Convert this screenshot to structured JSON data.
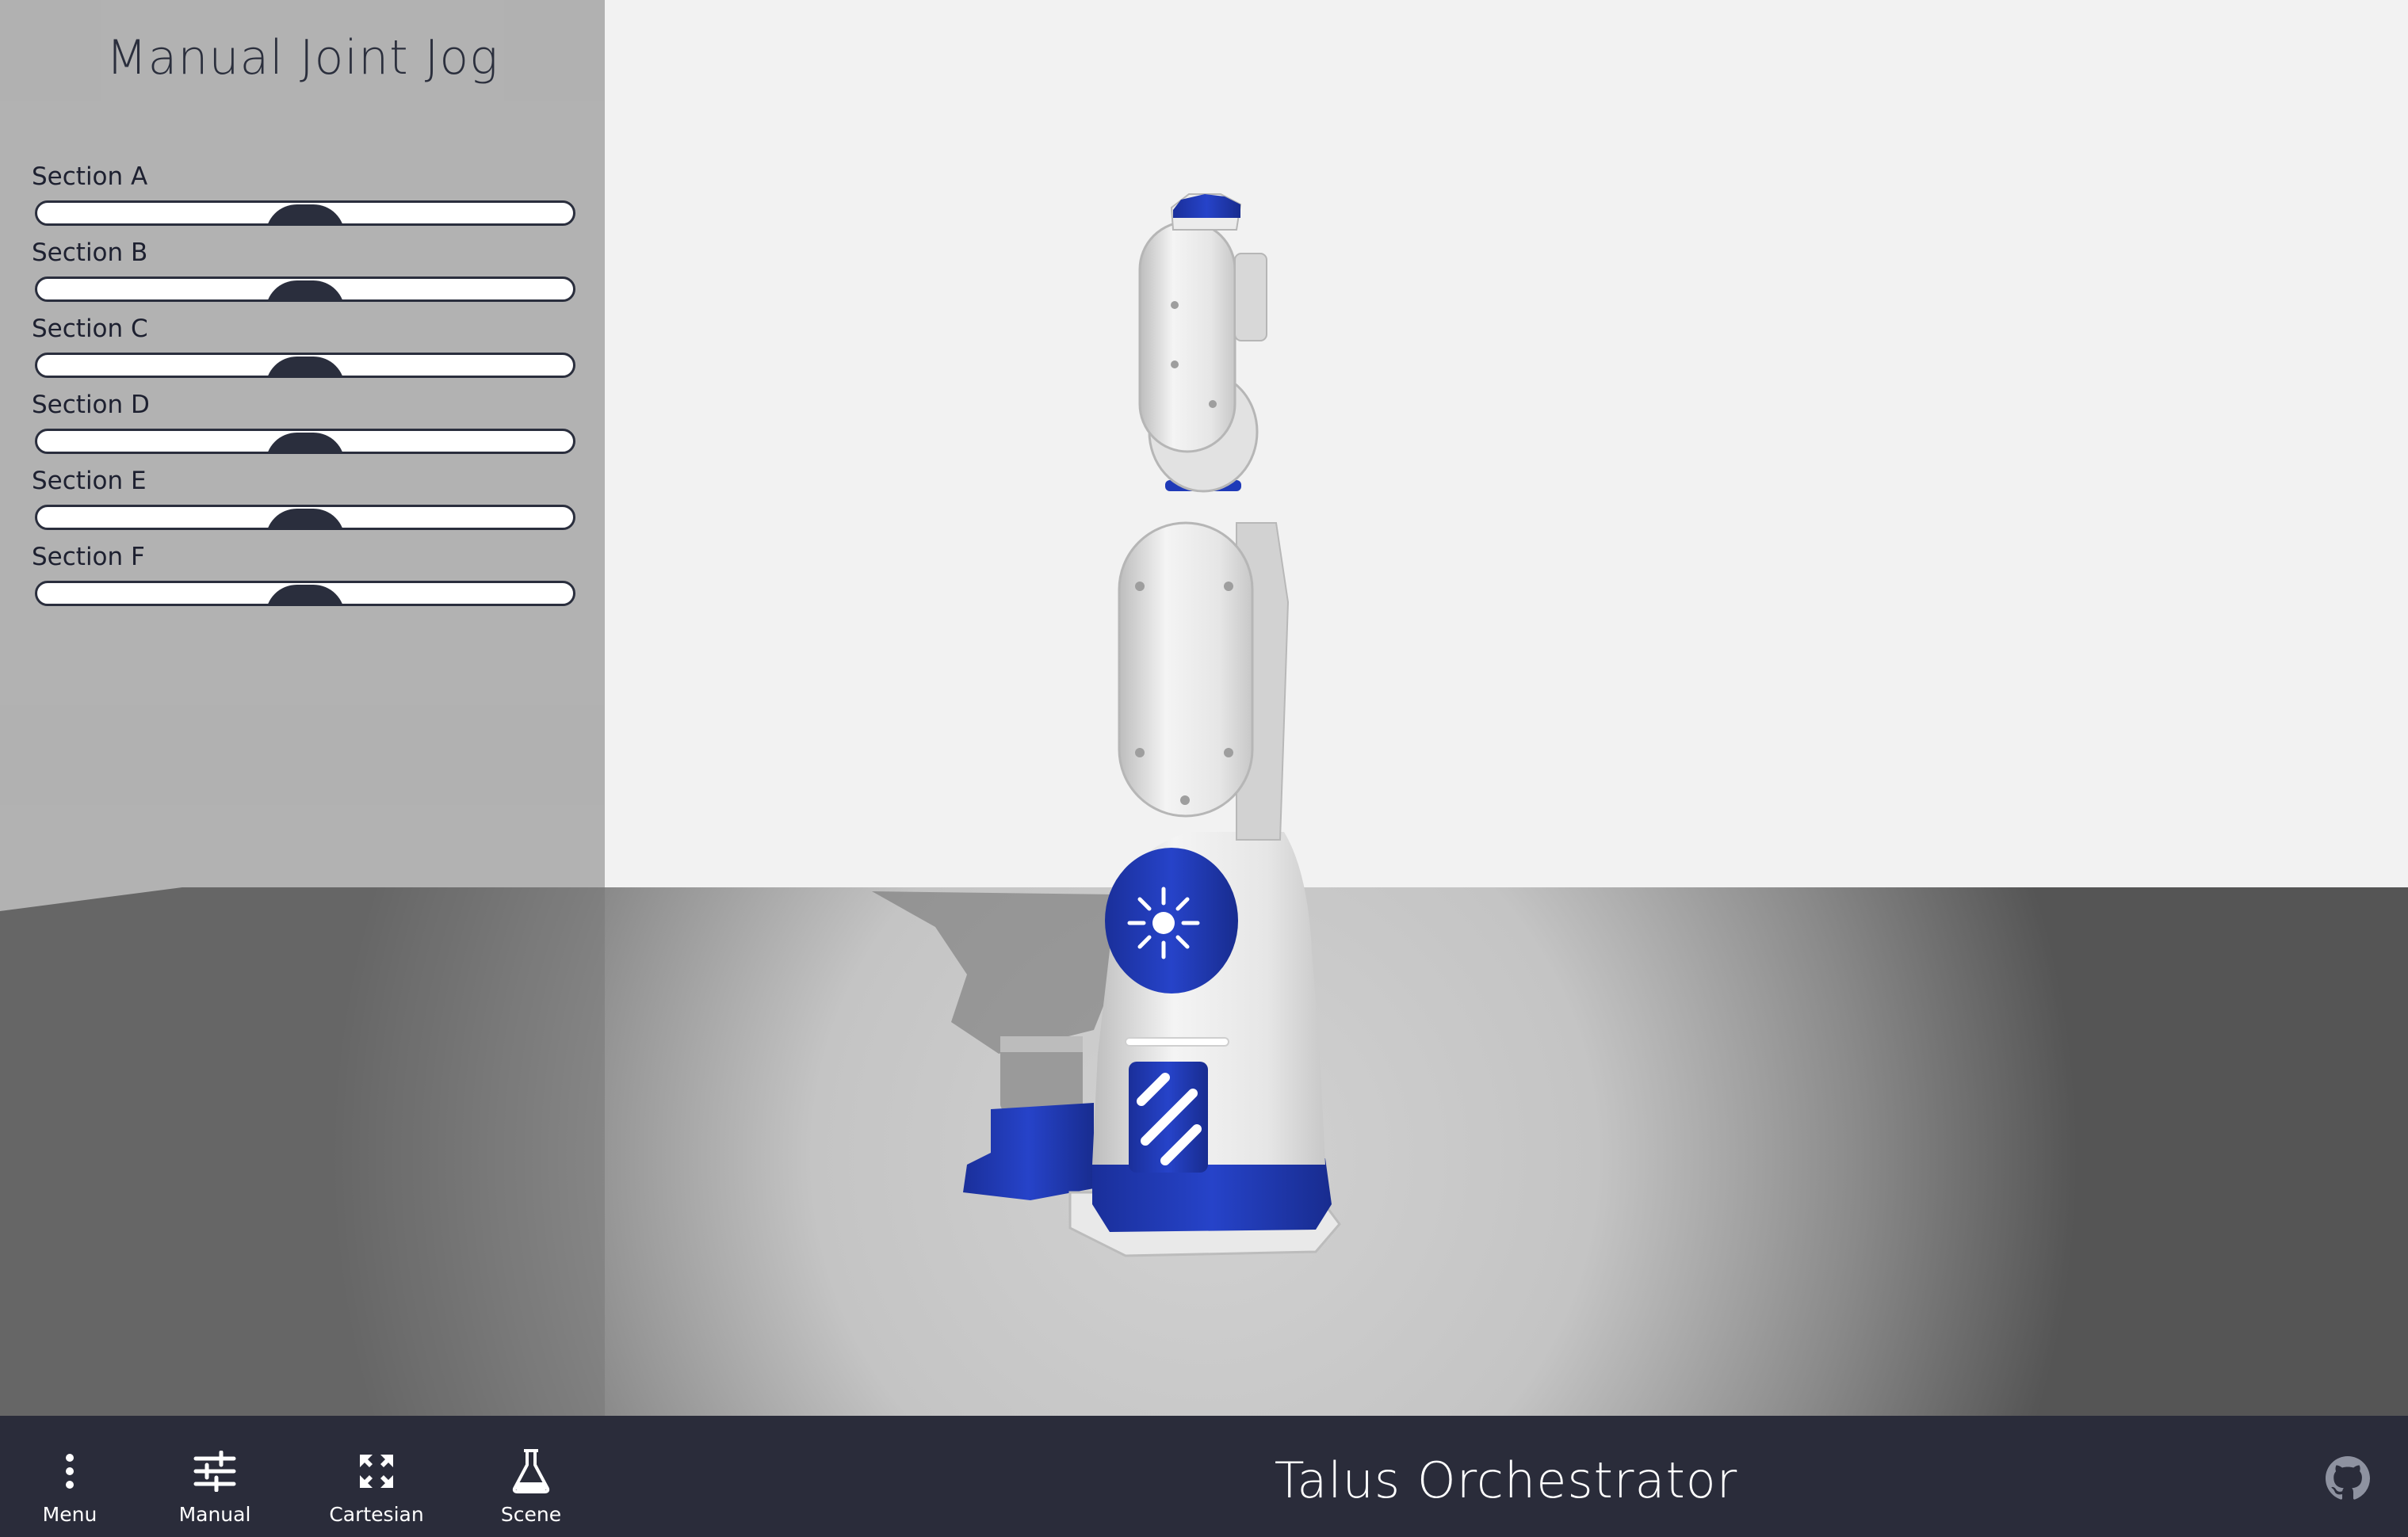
{
  "app": {
    "title": "Talus Orchestrator"
  },
  "panel": {
    "title": "Manual Joint Jog",
    "joints": [
      {
        "label": "Section A",
        "value": 0.5
      },
      {
        "label": "Section B",
        "value": 0.5
      },
      {
        "label": "Section C",
        "value": 0.5
      },
      {
        "label": "Section D",
        "value": 0.5
      },
      {
        "label": "Section E",
        "value": 0.5
      },
      {
        "label": "Section F",
        "value": 0.5
      }
    ]
  },
  "nav": {
    "menu": {
      "label": "Menu",
      "icon": "more-vertical-icon"
    },
    "manual": {
      "label": "Manual",
      "icon": "sliders-icon"
    },
    "cartesian": {
      "label": "Cartesian",
      "icon": "expand-arrows-icon"
    },
    "scene": {
      "label": "Scene",
      "icon": "flask-icon"
    },
    "github": {
      "icon": "github-icon"
    }
  },
  "colors": {
    "bar": "#2a2c3a",
    "accent": "#1f3ab8",
    "robot": "#e4e4e4"
  }
}
